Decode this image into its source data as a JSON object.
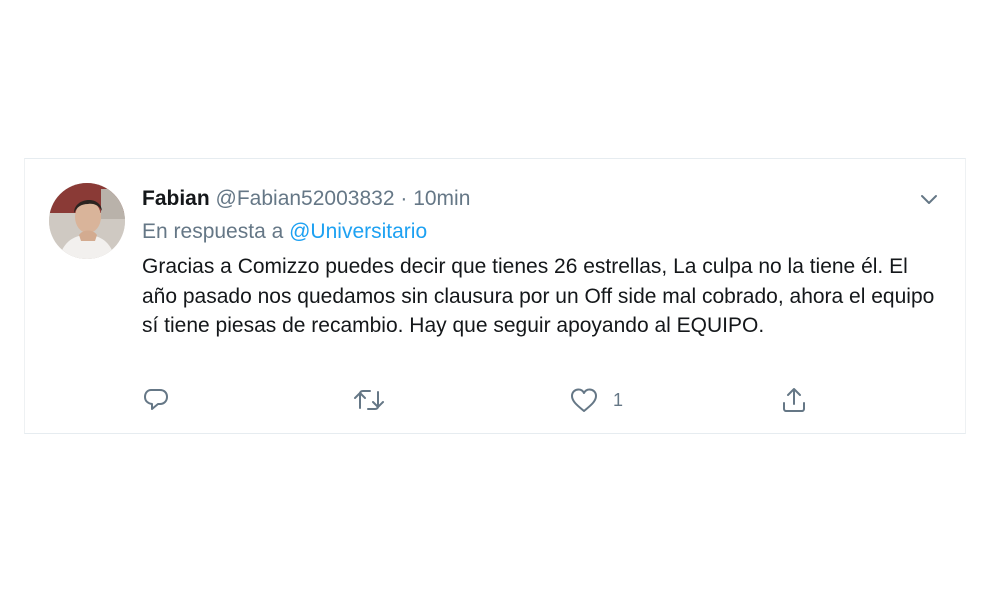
{
  "tweet": {
    "author_name": "Fabian",
    "author_handle": "@Fabian52003832",
    "separator": "·",
    "time": "10min",
    "reply_prefix": "En respuesta a",
    "reply_to": "@Universitario",
    "text": "Gracias a Comizzo puedes decir que tienes 26 estrellas, La culpa no la tiene él. El año pasado nos quedamos sin clausura por un Off side mal cobrado, ahora el equipo sí tiene piesas de recambio. Hay que seguir apoyando al EQUIPO.",
    "actions": {
      "reply_count": "",
      "retweet_count": "",
      "like_count": "1"
    }
  },
  "icons": {
    "menu": "chevron-down-icon",
    "reply": "speech-bubble-icon",
    "retweet": "retweet-icon",
    "like": "heart-icon",
    "share": "share-icon"
  },
  "colors": {
    "link": "#1da1f2",
    "text": "#14171a",
    "secondary": "#657786",
    "border": "#e6ecf0"
  }
}
